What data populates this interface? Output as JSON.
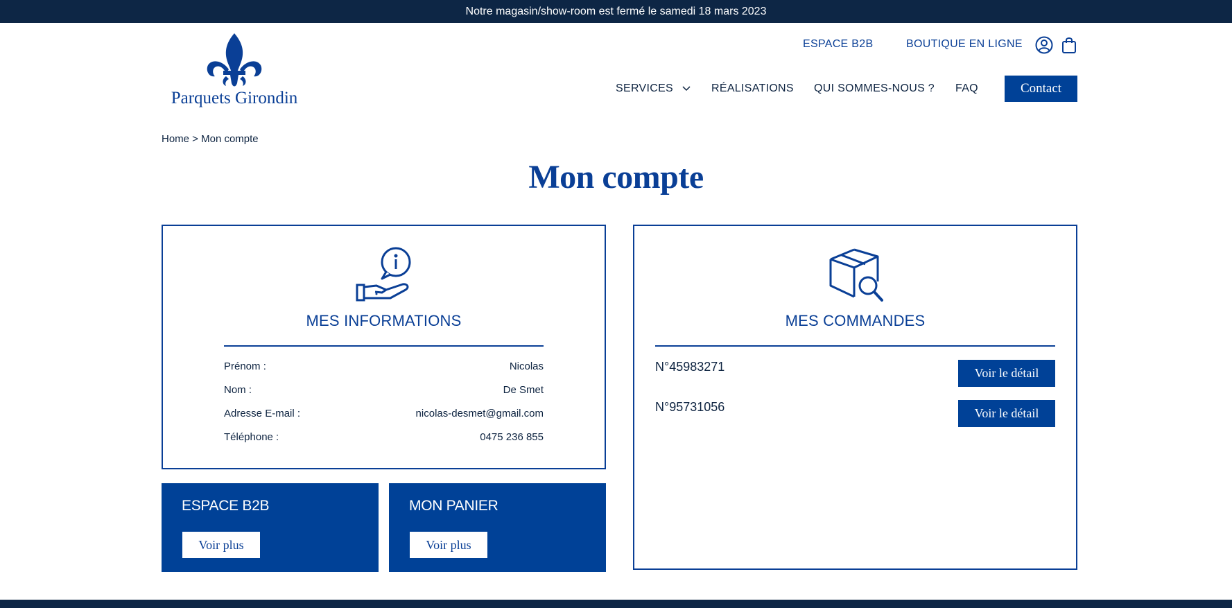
{
  "announcement": "Notre magasin/show-room est fermé le samedi 18 mars 2023",
  "brand": {
    "name": "Parquets Girondin",
    "color": "#0a3f96",
    "dark": "#0d2645",
    "button": "#004197"
  },
  "top_links": {
    "b2b": "ESPACE B2B",
    "shop": "BOUTIQUE EN LIGNE"
  },
  "header_icons": {
    "account": "user-icon",
    "cart": "shopping-bag-icon"
  },
  "nav": {
    "services": "SERVICES",
    "realisations": "RÉALISATIONS",
    "about": "QUI SOMMES-NOUS ?",
    "faq": "FAQ",
    "contact": "Contact"
  },
  "breadcrumb": "Home > Mon compte",
  "page_title": "Mon compte",
  "info_card": {
    "icon": "hand-info-icon",
    "title": "MES INFORMATIONS",
    "rows": [
      {
        "label": "Prénom :",
        "value": "Nicolas"
      },
      {
        "label": "Nom :",
        "value": "De Smet"
      },
      {
        "label": "Adresse E-mail :",
        "value": "nicolas-desmet@gmail.com"
      },
      {
        "label": "Téléphone :",
        "value": "0475 236 855"
      }
    ]
  },
  "orders_card": {
    "icon": "package-search-icon",
    "title": "MES COMMANDES",
    "orders": [
      {
        "id": "N°45983271",
        "button": "Voir le détail"
      },
      {
        "id": "N°95731056",
        "button": "Voir le détail"
      }
    ]
  },
  "b2b_card": {
    "title": "ESPACE B2B",
    "button": "Voir plus"
  },
  "cart_card": {
    "title": "MON PANIER",
    "button": "Voir plus"
  }
}
